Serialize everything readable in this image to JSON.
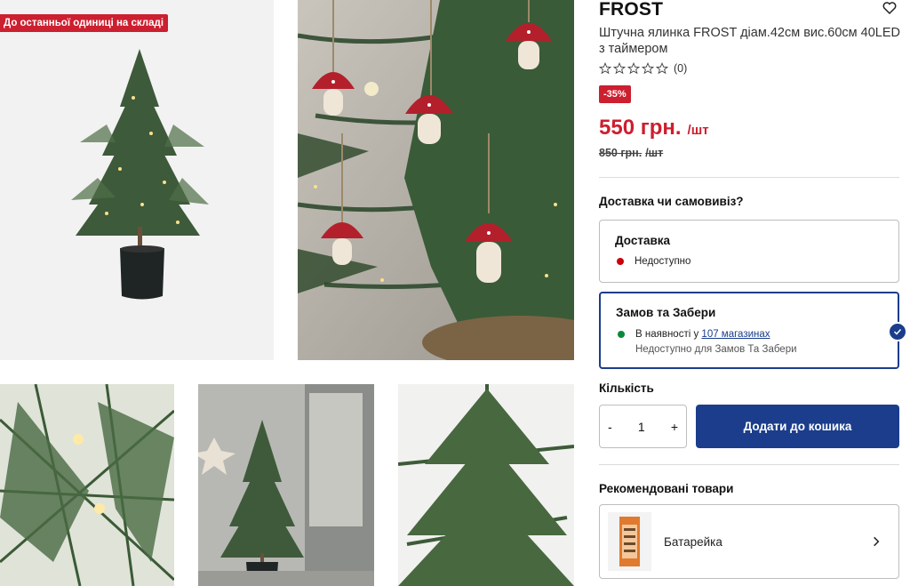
{
  "badge": "До останньої одиниці на складі",
  "brand": "FROST",
  "description": "Штучна ялинка FROST діам.42см вис.60см 40LED з таймером",
  "rating": {
    "stars": 0,
    "max": 5,
    "count": "(0)"
  },
  "discount": "-35%",
  "price": {
    "value": "550 грн.",
    "unit": "/шт",
    "old_value": "850 грн.",
    "old_unit": "/шт"
  },
  "delivery_question": "Доставка чи самовивіз?",
  "delivery": {
    "title": "Доставка",
    "status": "Недоступно",
    "status_color": "#cc0008"
  },
  "pickup": {
    "title": "Замов та Забери",
    "availability_prefix": "В наявності у",
    "availability_link": "107 магазинах",
    "note": "Недоступно для Замов Та Забери",
    "status_color": "#0a8a3a"
  },
  "quantity": {
    "label": "Кількість",
    "value": "1",
    "minus": "-",
    "plus": "+"
  },
  "add_to_cart": "Додати до кошика",
  "recommended": {
    "title": "Рекомендовані товари",
    "item": "Батарейка"
  },
  "colors": {
    "accent": "#1b3d8b",
    "sale": "#cc1f2f"
  },
  "icons": [
    "heart-icon",
    "star-outline-icon",
    "check-icon",
    "chevron-right-icon"
  ]
}
